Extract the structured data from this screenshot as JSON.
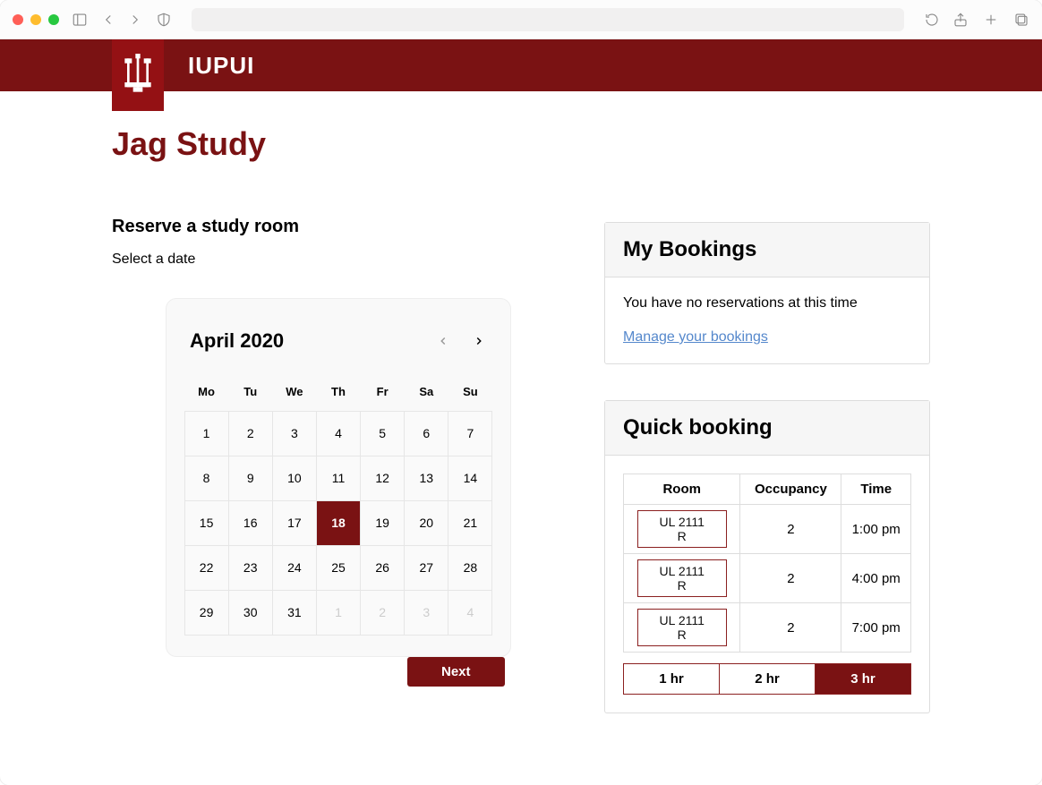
{
  "brand": {
    "name": "IUPUI"
  },
  "page": {
    "title": "Jag Study",
    "subtitle": "Reserve a study room",
    "instruction": "Select a date",
    "next_button": "Next"
  },
  "calendar": {
    "month_label": "April 2020",
    "dow": [
      "Mo",
      "Tu",
      "We",
      "Th",
      "Fr",
      "Sa",
      "Su"
    ],
    "days": [
      {
        "n": "1"
      },
      {
        "n": "2"
      },
      {
        "n": "3"
      },
      {
        "n": "4"
      },
      {
        "n": "5"
      },
      {
        "n": "6"
      },
      {
        "n": "7"
      },
      {
        "n": "8"
      },
      {
        "n": "9"
      },
      {
        "n": "10"
      },
      {
        "n": "11"
      },
      {
        "n": "12"
      },
      {
        "n": "13"
      },
      {
        "n": "14"
      },
      {
        "n": "15"
      },
      {
        "n": "16"
      },
      {
        "n": "17"
      },
      {
        "n": "18",
        "selected": true
      },
      {
        "n": "19"
      },
      {
        "n": "20"
      },
      {
        "n": "21"
      },
      {
        "n": "22"
      },
      {
        "n": "23"
      },
      {
        "n": "24"
      },
      {
        "n": "25"
      },
      {
        "n": "26"
      },
      {
        "n": "27"
      },
      {
        "n": "28"
      },
      {
        "n": "29"
      },
      {
        "n": "30"
      },
      {
        "n": "31"
      },
      {
        "n": "1",
        "faded": true
      },
      {
        "n": "2",
        "faded": true
      },
      {
        "n": "3",
        "faded": true
      },
      {
        "n": "4",
        "faded": true
      }
    ]
  },
  "bookings": {
    "heading": "My Bookings",
    "empty_text": "You have no reservations at this time",
    "manage_link": "Manage your bookings"
  },
  "quick": {
    "heading": "Quick booking",
    "columns": {
      "room": "Room",
      "occupancy": "Occupancy",
      "time": "Time"
    },
    "rows": [
      {
        "room": "UL 2111 R",
        "occupancy": "2",
        "time": "1:00 pm"
      },
      {
        "room": "UL 2111 R",
        "occupancy": "2",
        "time": "4:00 pm"
      },
      {
        "room": "UL 2111 R",
        "occupancy": "2",
        "time": "7:00 pm"
      }
    ],
    "durations": [
      {
        "label": "1 hr"
      },
      {
        "label": "2 hr"
      },
      {
        "label": "3 hr",
        "selected": true
      }
    ]
  }
}
